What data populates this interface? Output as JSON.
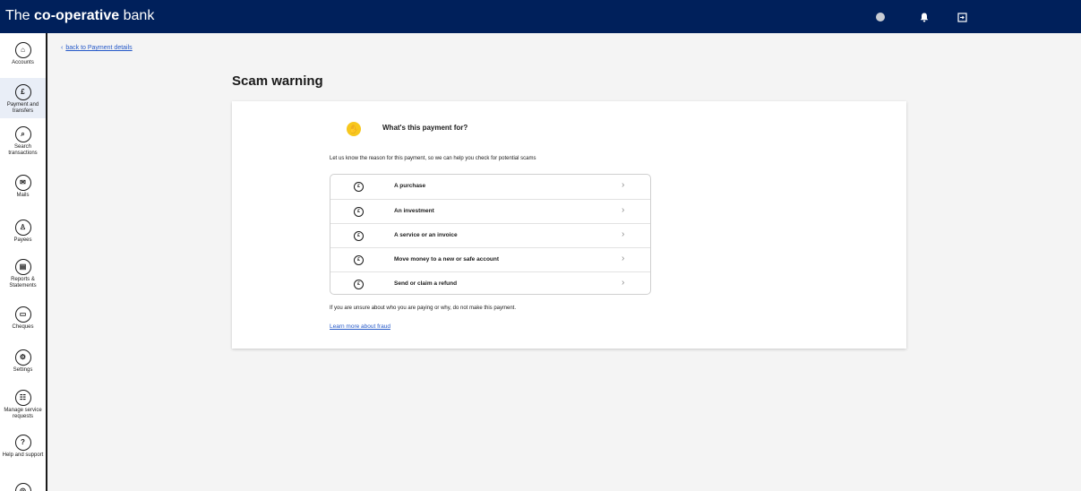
{
  "header": {
    "logo_prefix": "The",
    "logo_bold": "co-operative",
    "logo_suffix": "bank",
    "icons": [
      "profile-icon",
      "bell-icon",
      "logout-icon"
    ],
    "bg_color": "#00205b"
  },
  "sidebar": {
    "items": [
      {
        "label": "Accounts",
        "icon": "home-icon",
        "glyph": "⌂"
      },
      {
        "label": "Payment and transfers",
        "icon": "payment-icon",
        "glyph": "£",
        "active": true
      },
      {
        "label": "Search transactions",
        "icon": "search-icon",
        "glyph": "⌕"
      },
      {
        "label": "Mails",
        "icon": "mail-icon",
        "glyph": "✉"
      },
      {
        "label": "Payees",
        "icon": "payees-icon",
        "glyph": "♙"
      },
      {
        "label": "Reports & Statements",
        "icon": "statements-icon",
        "glyph": "▤"
      },
      {
        "label": "Cheques",
        "icon": "cheque-icon",
        "glyph": "▭"
      },
      {
        "label": "Settings",
        "icon": "settings-icon",
        "glyph": "⚙"
      },
      {
        "label": "Manage service requests",
        "icon": "service-requests-icon",
        "glyph": "☷"
      },
      {
        "label": "Help and support",
        "icon": "help-icon",
        "glyph": "?"
      },
      {
        "label": "",
        "icon": "more-icon",
        "glyph": "◎"
      }
    ]
  },
  "main": {
    "back_link": "back to Payment details",
    "title": "Scam warning",
    "question": "What's this payment for?",
    "intro": "Let us know the reason for this payment, so we can help you check for potential scams",
    "options": [
      {
        "label": "A purchase"
      },
      {
        "label": "An investment"
      },
      {
        "label": "A service or an invoice"
      },
      {
        "label": "Move money to a new or safe account"
      },
      {
        "label": "Send or claim a refund"
      }
    ],
    "option_icon_glyph": "£",
    "warning": "If you are unsure about who you are paying or why, do not make this payment.",
    "fraud_link": "Learn more about fraud"
  }
}
